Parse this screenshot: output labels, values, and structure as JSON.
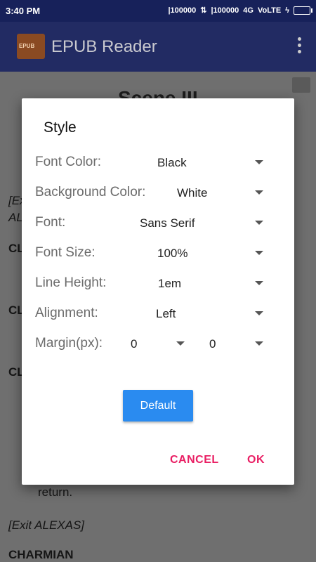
{
  "status_bar": {
    "time": "3:40 PM",
    "signal1": "|100000",
    "signal2": "|100000",
    "network": "4G",
    "volte": "VoLTE"
  },
  "app_bar": {
    "logo_text": "EPUB",
    "title": "EPUB Reader"
  },
  "book": {
    "heading": "Scene III",
    "fragments": [
      "[Ex",
      "AL",
      "CL",
      "CL",
      "CL",
      "return.",
      "[Exit ALEXAS]",
      "CHARMIAN"
    ]
  },
  "dialog": {
    "title": "Style",
    "rows": [
      {
        "label": "Font Color:",
        "value": "Black"
      },
      {
        "label": "Background Color:",
        "value": "White"
      },
      {
        "label": "Font:",
        "value": "Sans Serif"
      },
      {
        "label": "Font Size:",
        "value": "100%"
      },
      {
        "label": "Line Height:",
        "value": "1em"
      },
      {
        "label": "Alignment:",
        "value": "Left"
      }
    ],
    "margin": {
      "label": "Margin(px):",
      "value1": "0",
      "value2": "0"
    },
    "default_button": "Default",
    "cancel_button": "CANCEL",
    "ok_button": "OK"
  }
}
